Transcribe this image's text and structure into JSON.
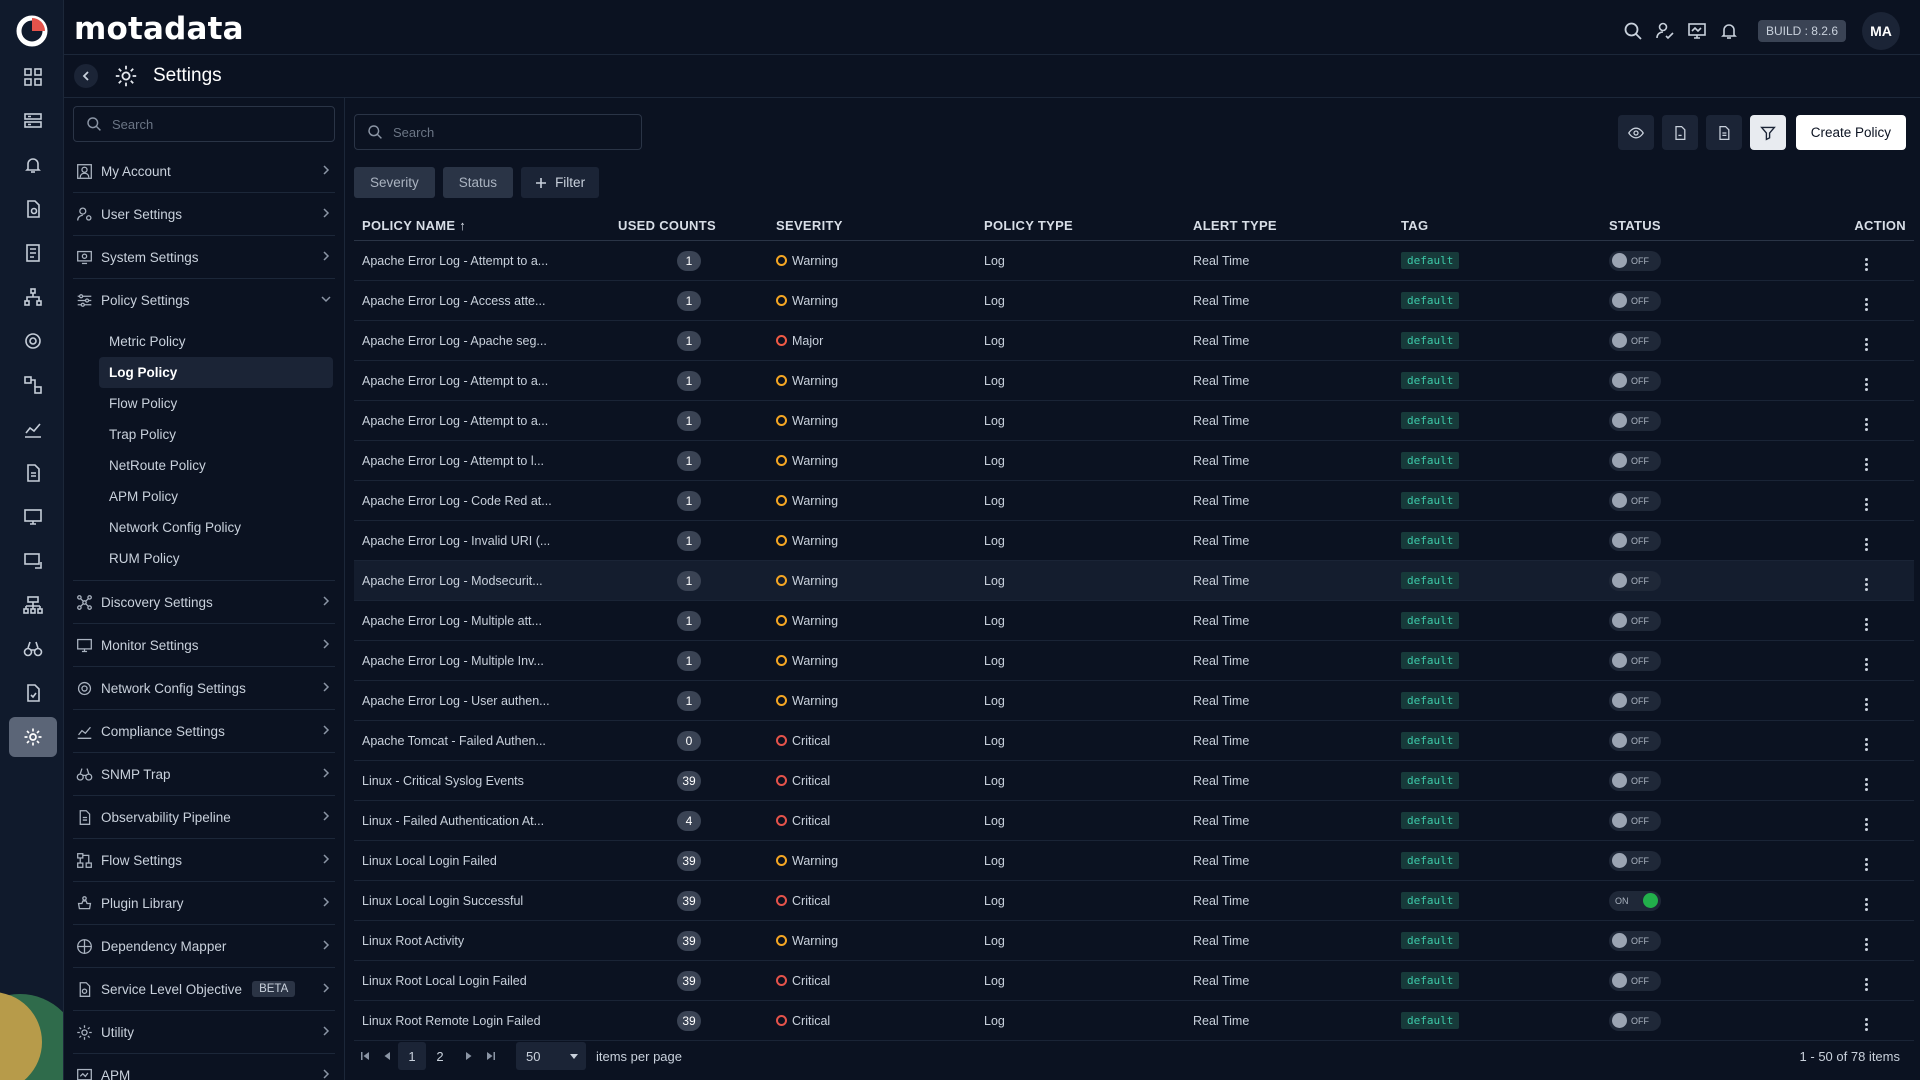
{
  "app": {
    "brand": "motadata",
    "page_title": "Settings",
    "build": "BUILD : 8.2.6",
    "avatar_initials": "MA"
  },
  "sidebar": {
    "search_placeholder": "Search",
    "items": [
      {
        "label": "My Account"
      },
      {
        "label": "User Settings"
      },
      {
        "label": "System Settings"
      },
      {
        "label": "Policy Settings"
      },
      {
        "label": "Discovery Settings"
      },
      {
        "label": "Monitor Settings"
      },
      {
        "label": "Network Config Settings"
      },
      {
        "label": "Compliance Settings"
      },
      {
        "label": "SNMP Trap"
      },
      {
        "label": "Observability Pipeline"
      },
      {
        "label": "Flow Settings"
      },
      {
        "label": "Plugin Library"
      },
      {
        "label": "Dependency Mapper"
      },
      {
        "label": "Service Level Objective",
        "badge": "BETA"
      },
      {
        "label": "Utility"
      },
      {
        "label": "APM"
      }
    ],
    "policy_sub": [
      "Metric Policy",
      "Log Policy",
      "Flow Policy",
      "Trap Policy",
      "NetRoute Policy",
      "APM Policy",
      "Network Config Policy",
      "RUM Policy"
    ]
  },
  "main": {
    "search_placeholder": "Search",
    "create_label": "Create Policy",
    "chips": {
      "severity": "Severity",
      "status": "Status",
      "filter": "Filter"
    }
  },
  "table": {
    "headers": {
      "name": "POLICY NAME ↑",
      "used": "USED COUNTS",
      "severity": "SEVERITY",
      "ptype": "POLICY TYPE",
      "atype": "ALERT TYPE",
      "tag": "TAG",
      "status": "STATUS",
      "action": "ACTION"
    },
    "rows": [
      {
        "name": "Apache Error Log - Attempt to a...",
        "used": "1",
        "severity": "Warning",
        "ptype": "Log",
        "atype": "Real Time",
        "tag": "default",
        "status": "OFF"
      },
      {
        "name": "Apache Error Log - Access atte...",
        "used": "1",
        "severity": "Warning",
        "ptype": "Log",
        "atype": "Real Time",
        "tag": "default",
        "status": "OFF"
      },
      {
        "name": "Apache Error Log - Apache seg...",
        "used": "1",
        "severity": "Major",
        "ptype": "Log",
        "atype": "Real Time",
        "tag": "default",
        "status": "OFF"
      },
      {
        "name": "Apache Error Log - Attempt to a...",
        "used": "1",
        "severity": "Warning",
        "ptype": "Log",
        "atype": "Real Time",
        "tag": "default",
        "status": "OFF"
      },
      {
        "name": "Apache Error Log - Attempt to a...",
        "used": "1",
        "severity": "Warning",
        "ptype": "Log",
        "atype": "Real Time",
        "tag": "default",
        "status": "OFF"
      },
      {
        "name": "Apache Error Log - Attempt to l...",
        "used": "1",
        "severity": "Warning",
        "ptype": "Log",
        "atype": "Real Time",
        "tag": "default",
        "status": "OFF"
      },
      {
        "name": "Apache Error Log - Code Red at...",
        "used": "1",
        "severity": "Warning",
        "ptype": "Log",
        "atype": "Real Time",
        "tag": "default",
        "status": "OFF"
      },
      {
        "name": "Apache Error Log - Invalid URI (...",
        "used": "1",
        "severity": "Warning",
        "ptype": "Log",
        "atype": "Real Time",
        "tag": "default",
        "status": "OFF"
      },
      {
        "name": "Apache Error Log - Modsecurit...",
        "used": "1",
        "severity": "Warning",
        "ptype": "Log",
        "atype": "Real Time",
        "tag": "default",
        "status": "OFF"
      },
      {
        "name": "Apache Error Log - Multiple att...",
        "used": "1",
        "severity": "Warning",
        "ptype": "Log",
        "atype": "Real Time",
        "tag": "default",
        "status": "OFF"
      },
      {
        "name": "Apache Error Log - Multiple Inv...",
        "used": "1",
        "severity": "Warning",
        "ptype": "Log",
        "atype": "Real Time",
        "tag": "default",
        "status": "OFF"
      },
      {
        "name": "Apache Error Log - User authen...",
        "used": "1",
        "severity": "Warning",
        "ptype": "Log",
        "atype": "Real Time",
        "tag": "default",
        "status": "OFF"
      },
      {
        "name": "Apache Tomcat - Failed Authen...",
        "used": "0",
        "severity": "Critical",
        "ptype": "Log",
        "atype": "Real Time",
        "tag": "default",
        "status": "OFF"
      },
      {
        "name": "Linux - Critical Syslog Events",
        "used": "39",
        "severity": "Critical",
        "ptype": "Log",
        "atype": "Real Time",
        "tag": "default",
        "status": "OFF"
      },
      {
        "name": "Linux - Failed Authentication At...",
        "used": "4",
        "severity": "Critical",
        "ptype": "Log",
        "atype": "Real Time",
        "tag": "default",
        "status": "OFF"
      },
      {
        "name": "Linux Local Login Failed",
        "used": "39",
        "severity": "Warning",
        "ptype": "Log",
        "atype": "Real Time",
        "tag": "default",
        "status": "OFF"
      },
      {
        "name": "Linux Local Login Successful",
        "used": "39",
        "severity": "Critical",
        "ptype": "Log",
        "atype": "Real Time",
        "tag": "default",
        "status": "ON"
      },
      {
        "name": "Linux Root Activity",
        "used": "39",
        "severity": "Warning",
        "ptype": "Log",
        "atype": "Real Time",
        "tag": "default",
        "status": "OFF"
      },
      {
        "name": "Linux Root Local Login Failed",
        "used": "39",
        "severity": "Critical",
        "ptype": "Log",
        "atype": "Real Time",
        "tag": "default",
        "status": "OFF"
      },
      {
        "name": "Linux Root Remote Login Failed",
        "used": "39",
        "severity": "Critical",
        "ptype": "Log",
        "atype": "Real Time",
        "tag": "default",
        "status": "OFF"
      }
    ]
  },
  "pagination": {
    "pages": [
      "1",
      "2"
    ],
    "per_page": "50",
    "per_page_label": "items per page",
    "info": "1 - 50 of 78 items"
  },
  "colors": {
    "warning": "#f5a623",
    "critical": "#e5534b",
    "major": "#f05a45",
    "toggle_on": "#22b04b",
    "tag_text": "#3cc9a8",
    "background": "#0b1221"
  }
}
